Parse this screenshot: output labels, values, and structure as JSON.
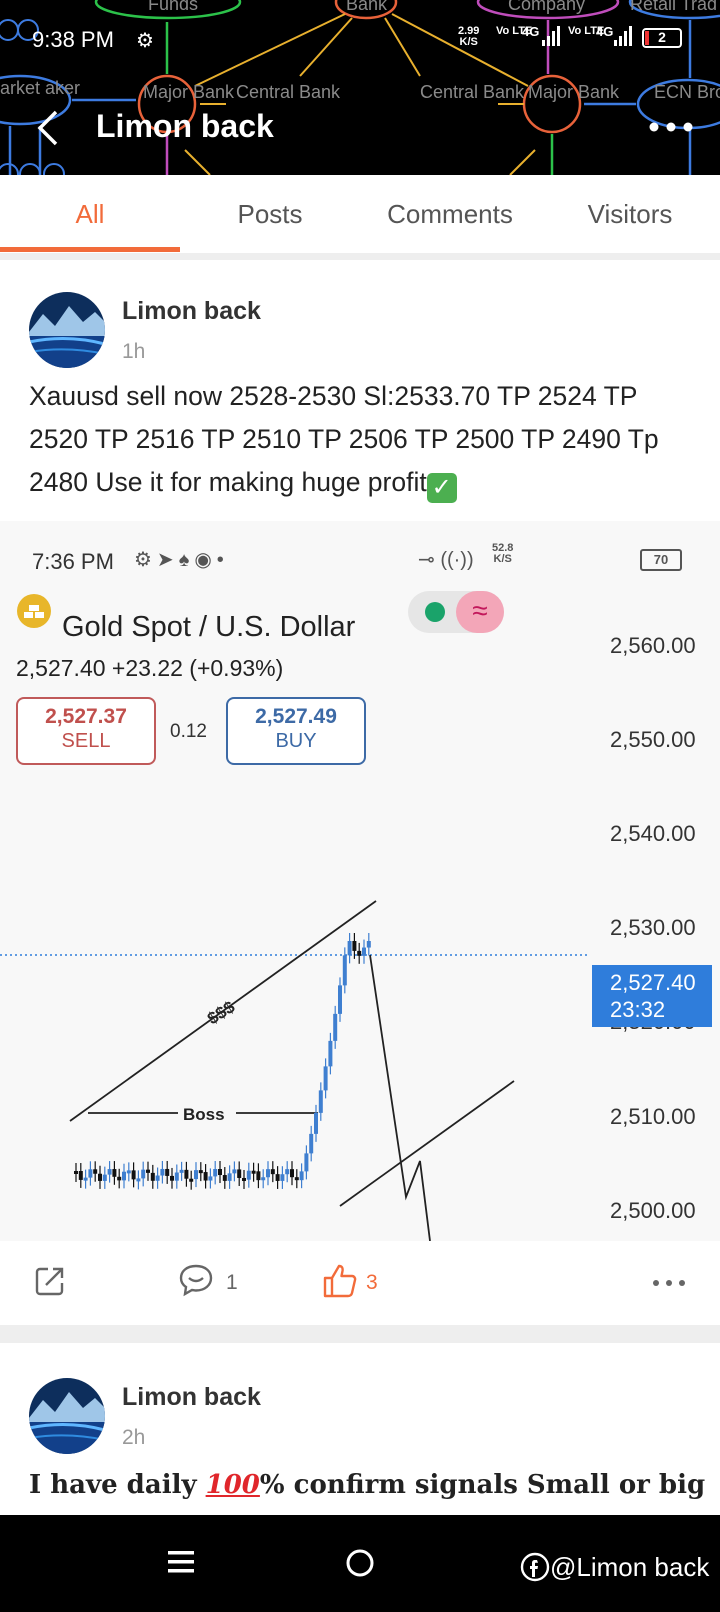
{
  "status_bar": {
    "time": "9:38 PM",
    "net_speed": "2.99",
    "net_unit": "K/S",
    "sim1": "Vo LTE",
    "sim1_net": "4G",
    "sim2": "Vo LTE",
    "sim2_net": "4G",
    "battery": "2"
  },
  "header": {
    "title": "Limon back",
    "banner_labels": {
      "funds": "Funds",
      "bank_top": "Bank",
      "company": "Company",
      "retail": "Retail Trad",
      "market_maker": "arket aker",
      "major_bank_left": "Major Bank",
      "central_bank_left": "Central Bank",
      "central_bank_right": "Central Bank",
      "major_bank_right": "Major Bank",
      "ecn_brokers": "ECN Broker"
    }
  },
  "tabs": [
    {
      "label": "All",
      "active": true
    },
    {
      "label": "Posts",
      "active": false
    },
    {
      "label": "Comments",
      "active": false
    },
    {
      "label": "Visitors",
      "active": false
    }
  ],
  "post1": {
    "author": "Limon back",
    "time": "1h",
    "text": "Xauusd sell now 2528-2530 Sl:2533.70 TP 2524 TP 2520 TP 2516 TP 2510 TP 2506 TP 2500 TP 2490 Tp 2480 Use it for making huge profit",
    "emoji_check": "✓"
  },
  "embedded_screenshot": {
    "time": "7:36 PM",
    "net_speed": "52.8",
    "net_unit": "K/S",
    "battery": "70",
    "asset_title": "Gold Spot / U.S. Dollar",
    "price_line": "2,527.40  +23.22 (+0.93%)",
    "sell_price": "2,527.37",
    "sell_label": "SELL",
    "spread": "0.12",
    "buy_price": "2,527.49",
    "buy_label": "BUY",
    "y_axis_labels": [
      "2,560.00",
      "2,550.00",
      "2,540.00",
      "2,530.00",
      "2,520.00",
      "2,510.00",
      "2,500.00"
    ],
    "current_price": "2,527.40",
    "countdown": "23:32",
    "annotation_liquidity": "$$$",
    "annotation_boss": "Boss",
    "colors": {
      "up": "#3f7fd0",
      "down": "#111111",
      "price_tag": "#2f7ddb"
    }
  },
  "actions": {
    "comments": "1",
    "likes": "3",
    "accent": "#f26b3a"
  },
  "post2": {
    "author": "Limon back",
    "time": "2h",
    "text_before": "I have daily ",
    "text_hundred": "100",
    "text_after": "% confirm signals Small or big"
  },
  "navbar": {
    "watermark": "@Limon back"
  }
}
